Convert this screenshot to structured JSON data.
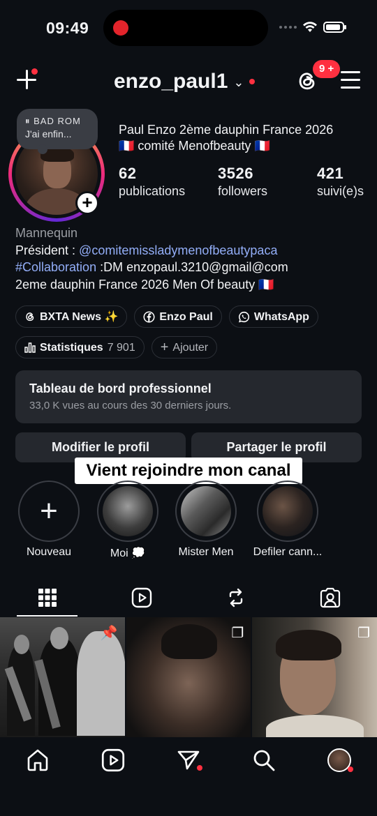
{
  "status_bar": {
    "time": "09:49"
  },
  "header": {
    "username": "enzo_paul1",
    "notification_badge": "9 +"
  },
  "note": {
    "line1": "BAD ROM",
    "line2": "J'ai enfin..."
  },
  "profile": {
    "full_name_line1": "Paul Enzo 2ème dauphin France 2026",
    "full_name_line2": "🇫🇷 comité Menofbeauty 🇫🇷",
    "stats": [
      {
        "num": "62",
        "label": "publications"
      },
      {
        "num": "3526",
        "label": "followers"
      },
      {
        "num": "421",
        "label": "suivi(e)s"
      }
    ]
  },
  "bio": {
    "category": "Mannequin",
    "line1_prefix": "Président : ",
    "line1_link": "@comitemissladymenofbeautypaca",
    "line2_tag": "#Collaboration",
    "line2_rest": " :DM enzopaul.3210@gmail@com",
    "line3": "2eme dauphin France 2026 Men Of beauty 🇫🇷"
  },
  "links": [
    {
      "icon": "threads-icon",
      "label": "BXTA News ✨"
    },
    {
      "icon": "facebook-icon",
      "label": "Enzo Paul"
    },
    {
      "icon": "whatsapp-icon",
      "label": "WhatsApp"
    }
  ],
  "tools": {
    "stats_label": "Statistiques",
    "stats_value": "7 901",
    "add_label": "Ajouter"
  },
  "dashboard": {
    "title": "Tableau de bord professionnel",
    "subtitle": "33,0 K vues au cours des 30 derniers jours."
  },
  "buttons": {
    "edit": "Modifier le profil",
    "share": "Partager le profil"
  },
  "video_caption": "Vient rejoindre mon canal",
  "highlights": [
    {
      "label": "Nouveau"
    },
    {
      "label": "Moi 💭"
    },
    {
      "label": "Mister Men"
    },
    {
      "label": "Defiler cann..."
    }
  ],
  "colors": {
    "background": "#0c0f14",
    "accent_link": "#93aef8",
    "notification": "#ff3040",
    "card": "#25282e"
  }
}
